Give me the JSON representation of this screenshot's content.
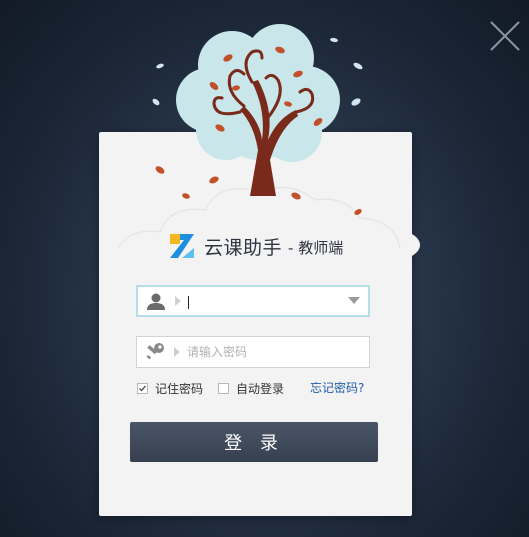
{
  "brand": {
    "name": "云课助手",
    "subtitle": "- 教师端",
    "logo_color": "#1d8fe0",
    "logo_accent": "#f3b81f"
  },
  "login": {
    "username_value": "",
    "password_placeholder": "请输入密码",
    "remember_label": "记住密码",
    "remember_checked": true,
    "autologin_label": "自动登录",
    "autologin_checked": false,
    "forgot_label": "忘记密码?",
    "submit_label": "登 录"
  },
  "icons": {
    "close": "close-icon",
    "user": "user-icon",
    "key": "key-icon",
    "dropdown": "chevron-down-icon"
  },
  "colors": {
    "button": "#3d4757",
    "link": "#1f5fa8",
    "active_border": "#b7dde6"
  }
}
